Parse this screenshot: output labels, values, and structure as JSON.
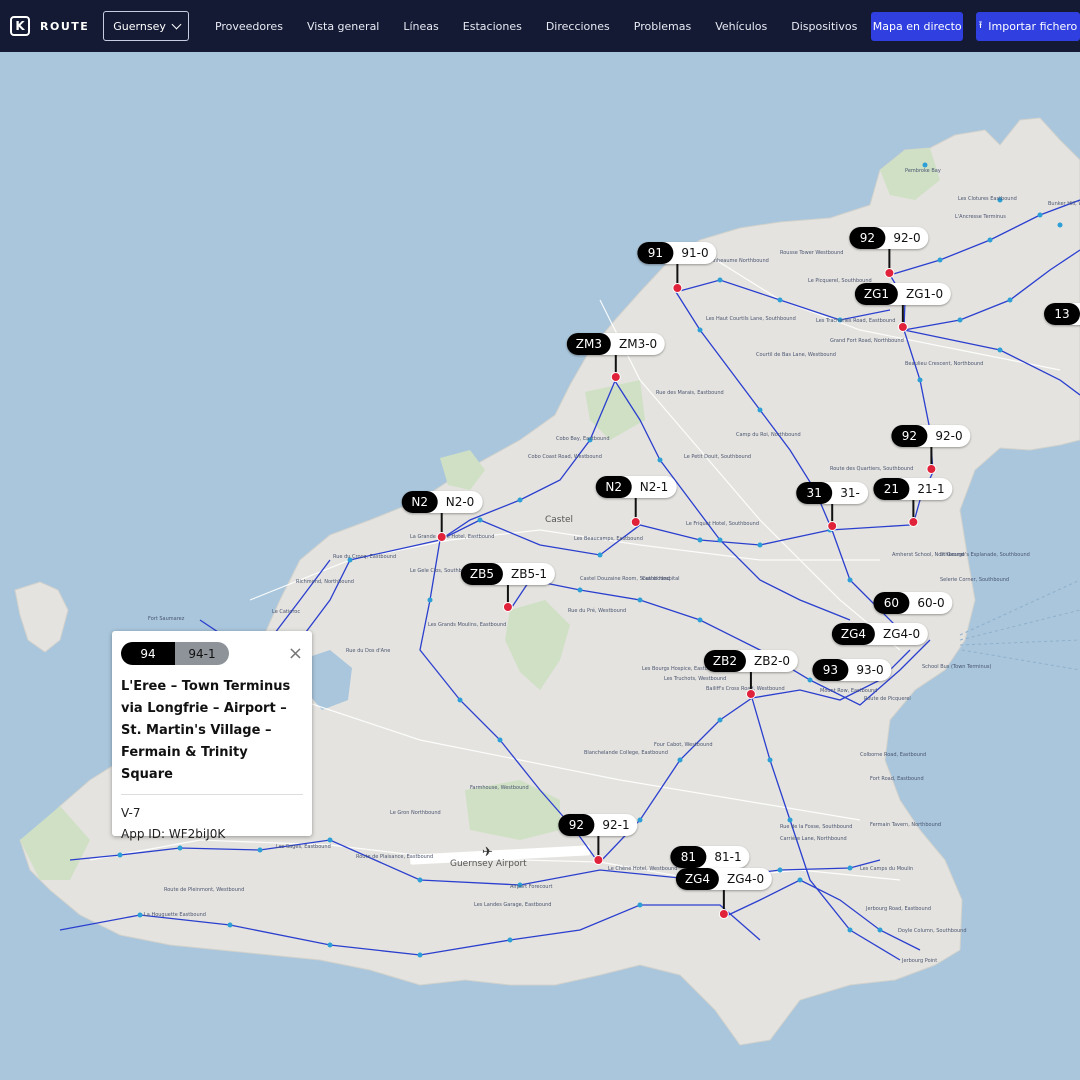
{
  "app": {
    "logo_glyph": "K",
    "brand": "ROUTE"
  },
  "region_select": {
    "value": "Guernsey"
  },
  "nav": [
    "Proveedores",
    "Vista general",
    "Líneas",
    "Estaciones",
    "Direcciones",
    "Problemas",
    "Vehículos",
    "Dispositivos"
  ],
  "actions": {
    "live_map": "Mapa en directo",
    "import_icon": "⭱",
    "import": "Importar fichero"
  },
  "map": {
    "towns": [
      "Castel",
      "Guernsey Airport"
    ],
    "stops": [
      "Rousse Tower Westbound",
      "Pembroke Bay",
      "Les Clotures Eastbound",
      "Bunker Hill, Westbound",
      "L'Ancresse Terminus",
      "Pleinheaume Northbound",
      "Le Picquerel, Southbound",
      "Grand Fort Road, Northbound",
      "Les Tracheries Road, Eastbound",
      "Beaulieu Crescent, Northbound",
      "Les Haut Courtils Lane, Southbound",
      "Courtil de Bas Lane, Westbound",
      "Rue des Marais, Eastbound",
      "Cobo Bay, Eastbound",
      "Cobo Coast Road, Westbound",
      "Le Petit Douit, Southbound",
      "Camp du Roi, Northbound",
      "Route des Quartiers, Southbound",
      "Le Friquet Hotel, Southbound",
      "Les Beaucamps, Eastbound",
      "Castel Douzaine Room, Southbound",
      "Castel Hospital",
      "Rue du Pré, Westbound",
      "Les Bourgs Hospice, Eastbound",
      "Les Truchots, Westbound",
      "Bailiff's Cross Road, Westbound",
      "Mount Row, Eastbound",
      "Blanchelande College, Eastbound",
      "Four Cabot, Westbound",
      "Le Gron Northbound",
      "Farmhouse, Westbound",
      "Route de Plaisance, Eastbound",
      "Les Sages, Eastbound",
      "Route de Pleinmont, Westbound",
      "La Houguette Eastbound",
      "Les Landes Garage, Eastbound",
      "Airport Forecourt",
      "Le Chêne Hotel, Westbound",
      "Carrière Lane, Northbound",
      "Rue de la Fosse, Southbound",
      "Les Camps du Moulin",
      "Jerbourg Road, Eastbound",
      "Doyle Column, Southbound",
      "Jerbourg Point",
      "Colborne Road, Eastbound",
      "Fort Road, Eastbound",
      "Fermain Tavern, Northbound",
      "Selerie Corner, Southbound",
      "Amherst School, Northbound",
      "St George's Esplanade, Southbound",
      "School Bus (Town Terminus)",
      "Route de Picquerel",
      "Richmond, Northbound",
      "Fort Saumarez",
      "Le Catioroc",
      "Rue du Dos d'Ane",
      "Les Grands Moulins, Eastbound",
      "La Grande Mare Hotel, Eastbound",
      "Le Gele Clos, Southbound",
      "Rue du Crocq, Eastbound"
    ]
  },
  "markers": [
    {
      "route": "91",
      "trip": "91-0"
    },
    {
      "route": "92",
      "trip": "92-0"
    },
    {
      "route": "ZG1",
      "trip": "ZG1-0"
    },
    {
      "route": "13",
      "trip": ""
    },
    {
      "route": "ZM3",
      "trip": "ZM3-0"
    },
    {
      "route": "92",
      "trip": "92-0"
    },
    {
      "route": "N2",
      "trip": "N2-0"
    },
    {
      "route": "N2",
      "trip": "N2-1"
    },
    {
      "route": "31",
      "trip": "31-"
    },
    {
      "route": "21",
      "trip": "21-1"
    },
    {
      "route": "ZB5",
      "trip": "ZB5-1"
    },
    {
      "route": "60",
      "trip": "60-0"
    },
    {
      "route": "ZG4",
      "trip": "ZG4-0"
    },
    {
      "route": "ZB2",
      "trip": "ZB2-0"
    },
    {
      "route": "93",
      "trip": "93-0"
    },
    {
      "route": "92",
      "trip": "92-1"
    },
    {
      "route": "81",
      "trip": "81-1"
    },
    {
      "route": "ZG4",
      "trip": "ZG4-0"
    }
  ],
  "popup": {
    "route": "94",
    "trip": "94-1",
    "close": "×",
    "title": "L'Eree – Town Terminus via Longfrie – Airport – St. Martin's Village – Fermain & Trinity Square",
    "vehicle": "V-7",
    "app_id": "App ID: WF2biJ0K"
  },
  "colors": {
    "accent": "#2f3fe0",
    "topbar": "#141a33",
    "marker_dot": "#e0223a",
    "route_lines": "#2b3fcf",
    "sea": "#a9c6dc",
    "land": "#e4e3df"
  }
}
